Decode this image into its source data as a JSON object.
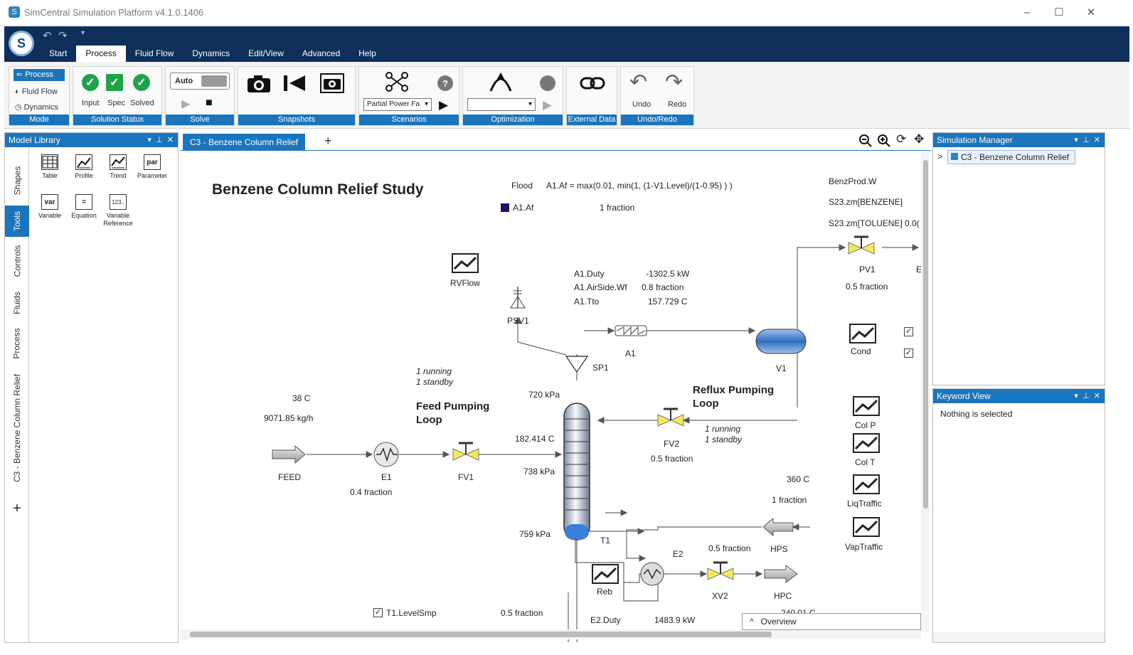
{
  "window": {
    "title": "SimCentral Simulation Platform v4.1.0.1406",
    "controls": [
      "–",
      "☐",
      "✕"
    ]
  },
  "ribbon_tabs": [
    "Start",
    "Process",
    "Fluid Flow",
    "Dynamics",
    "Edit/View",
    "Advanced",
    "Help"
  ],
  "ribbon": {
    "mode": {
      "label": "Mode",
      "items": [
        "Process",
        "Fluid Flow",
        "Dynamics"
      ]
    },
    "solution_status": {
      "label": "Solution Status",
      "items": [
        "Input",
        "Spec",
        "Solved"
      ]
    },
    "solve": {
      "label": "Solve",
      "toggle_text": "Auto"
    },
    "snapshots": {
      "label": "Snapshots"
    },
    "scenarios": {
      "label": "Scenarios",
      "dropdown_value": "Partial Power Fa",
      "help": "?"
    },
    "optimization": {
      "label": "Optimization",
      "dropdown_value": ""
    },
    "external_data": {
      "label": "External Data"
    },
    "undo_redo": {
      "label": "Undo/Redo",
      "undo": "Undo",
      "redo": "Redo"
    }
  },
  "model_library": {
    "title": "Model Library",
    "vertical_tabs": [
      "Shapes",
      "Tools",
      "Controls",
      "Fluids",
      "Process",
      "C3 - Benzene Column Relief"
    ],
    "add": "+",
    "tools": [
      {
        "label": "Table",
        "icon": "table-icon",
        "glyph": ""
      },
      {
        "label": "Profile",
        "icon": "profile-icon",
        "glyph": ""
      },
      {
        "label": "Trend",
        "icon": "trend-icon",
        "glyph": ""
      },
      {
        "label": "Parameter",
        "icon": "parameter-icon",
        "glyph": "par"
      },
      {
        "label": "Variable",
        "icon": "variable-icon",
        "glyph": "var"
      },
      {
        "label": "Equation",
        "icon": "equation-icon",
        "glyph": "="
      },
      {
        "label": "Variable",
        "label2": "Reference",
        "icon": "variable-reference-icon",
        "glyph": "123.."
      }
    ]
  },
  "document": {
    "tab": "C3 - Benzene Column Relief",
    "add_tab": "+",
    "overview": "Overview",
    "overview_chevron": "^"
  },
  "flowsheet": {
    "title": "Benzene Column Relief Study",
    "flood_label": "Flood",
    "flood_eq": "A1.Af = max(0.01, min(1, (1-V1.Level)/(1-0.95) ) )",
    "af_label": "A1.Af",
    "af_value": "1 fraction",
    "bp_labels": [
      "BenzProd.W",
      "S23.zm[BENZENE]",
      "S23.zm[TOLUENE]"
    ],
    "bp_value": "0.0(",
    "pv1_label": "PV1",
    "pv1_value": "0.5 fraction",
    "pv1_cut": "E",
    "rvflow": "RVFlow",
    "psv1": "PSV1",
    "a1_props": [
      "A1.Duty",
      "A1.AirSide.Wf",
      "A1.Tto"
    ],
    "a1_values": [
      "-1302.5 kW",
      "0.8 fraction",
      "157.729 C"
    ],
    "a1": "A1",
    "sp1": "SP1",
    "v1": "V1",
    "cond": "Cond",
    "feed_loop_status": [
      "1 running",
      "1 standby"
    ],
    "feed_loop_title": [
      "Feed Pumping",
      "Loop"
    ],
    "reflux_loop_title": [
      "Reflux Pumping",
      "Loop"
    ],
    "reflux_loop_status": [
      "1 running",
      "1 standby"
    ],
    "p_top": "720 kPa",
    "feed_temp": "38 C",
    "feed_flow": "9071.85 kg/h",
    "col_temp": "182.414 C",
    "p_feed": "738 kPa",
    "p_bottom": "759 kPa",
    "feed": "FEED",
    "e1": "E1",
    "e1_value": "0.4 fraction",
    "fv1": "FV1",
    "fv2": "FV2",
    "fv2_value": "0.5 fraction",
    "t1": "T1",
    "reb": "Reb",
    "e2": "E2",
    "xv2": "XV2",
    "xv2_value": "0.5 fraction",
    "hps": "HPS",
    "hps_temp": "360 C",
    "hps_value": "1 fraction",
    "hpc": "HPC",
    "hpc_cut": "240.01 C",
    "col_p": "Col P",
    "col_t": "Col T",
    "liq_traffic": "LiqTraffic",
    "vap_traffic": "VapTraffic",
    "t1_level": "T1.LevelSmp",
    "t1_level_value": "0.5 fraction",
    "e2_duty": "E2.Duty",
    "e2_duty_value": "1483.9 kW"
  },
  "simulation_manager": {
    "title": "Simulation Manager",
    "item": "C3 - Benzene Column Relief",
    "expander": ">"
  },
  "keyword_view": {
    "title": "Keyword View",
    "text": "Nothing is selected"
  },
  "colors": {
    "accent": "#1b75bc",
    "ribbon_dark": "#0e2f5a",
    "valve_yellow": "#f3ea59",
    "status_green": "#1ea34a",
    "af_marker": "#16166e"
  }
}
